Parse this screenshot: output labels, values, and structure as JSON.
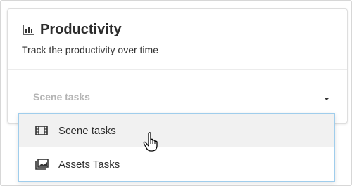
{
  "card": {
    "title": "Productivity",
    "subtitle": "Track the productivity over time",
    "title_icon": "bar-chart-icon"
  },
  "select": {
    "value": "Scene tasks",
    "caret_icon": "caret-down-icon"
  },
  "menu": {
    "items": [
      {
        "label": "Scene tasks",
        "icon": "film-icon",
        "active": true
      },
      {
        "label": "Assets Tasks",
        "icon": "images-icon",
        "active": false
      }
    ]
  },
  "colors": {
    "menu_border": "#9fcdec",
    "active_item_bg": "#f1f1f1",
    "placeholder_text": "#b5b5b5"
  }
}
